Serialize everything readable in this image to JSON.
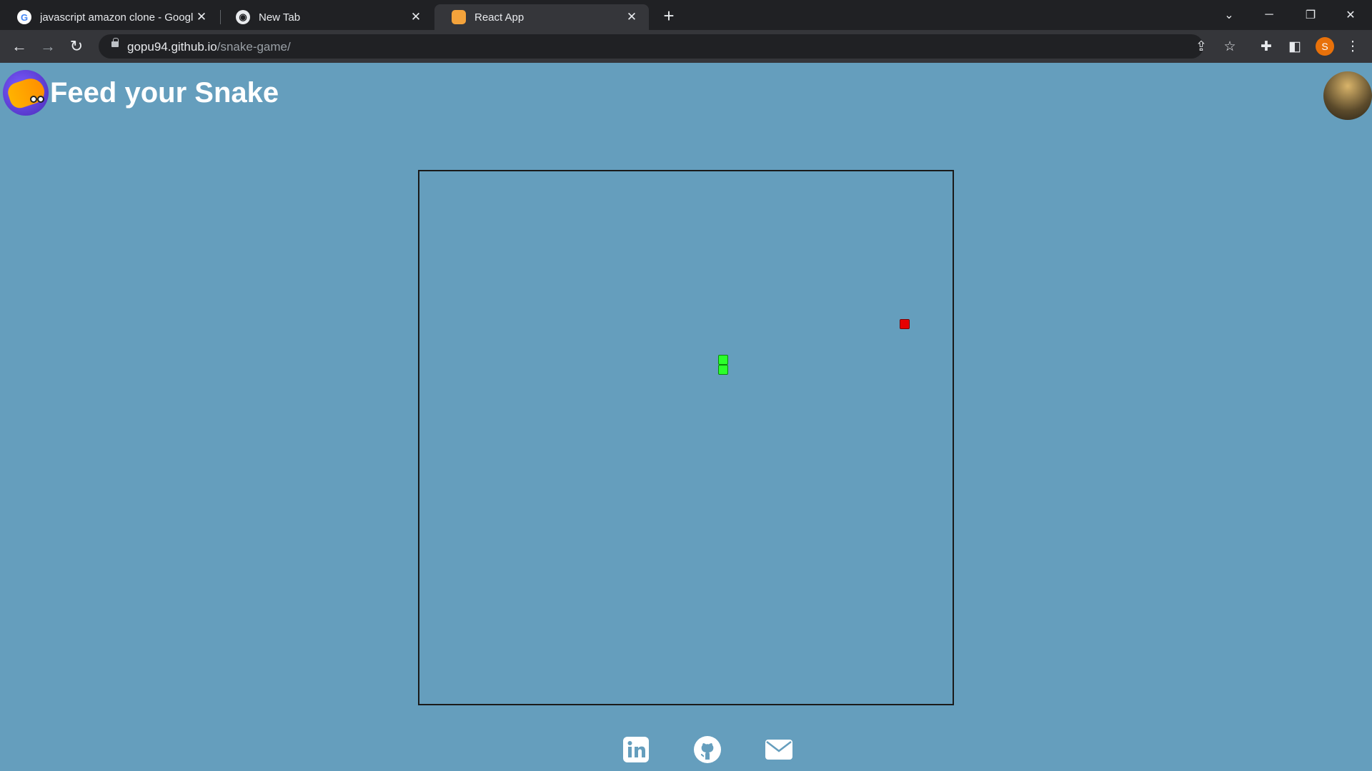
{
  "browser": {
    "tabs": [
      {
        "title": "javascript amazon clone - Googl",
        "favicon": "google-icon"
      },
      {
        "title": "New Tab",
        "favicon": "chrome-icon"
      },
      {
        "title": "React App",
        "favicon": "react-app-icon"
      }
    ],
    "url_host": "gopu94.github.io",
    "url_path": "/snake-game/",
    "profile_initial": "S"
  },
  "page": {
    "title": "Feed your Snake",
    "colors": {
      "background": "#659ebd",
      "snake": "#2bff2b",
      "food": "#e60000"
    },
    "social": [
      {
        "name": "linkedin-icon"
      },
      {
        "name": "github-icon"
      },
      {
        "name": "email-icon"
      }
    ]
  }
}
